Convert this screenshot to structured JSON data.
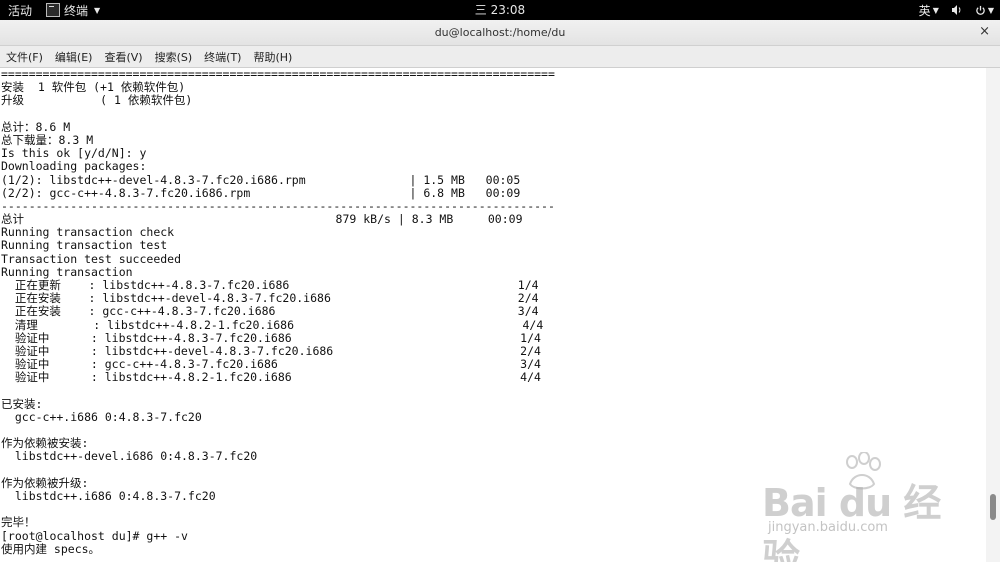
{
  "topbar": {
    "activities": "活动",
    "app_name": "终端",
    "clock": "三 23:08",
    "input_method": "英",
    "power_caret": "▾"
  },
  "window": {
    "title": "du@localhost:/home/du",
    "close_symbol": "×"
  },
  "menu": {
    "items": [
      "文件(F)",
      "编辑(E)",
      "查看(V)",
      "搜索(S)",
      "终端(T)",
      "帮助(H)"
    ]
  },
  "terminal": {
    "lines": [
      "================================================================================",
      "安装  1 软件包 (+1 依赖软件包)",
      "升级           ( 1 依赖软件包)",
      "",
      "总计：8.6 M",
      "总下载量：8.3 M",
      "Is this ok [y/d/N]: y",
      "Downloading packages:",
      "(1/2): libstdc++-devel-4.8.3-7.fc20.i686.rpm               | 1.5 MB   00:05",
      "(2/2): gcc-c++-4.8.3-7.fc20.i686.rpm                       | 6.8 MB   00:09",
      "--------------------------------------------------------------------------------",
      "总计                                             879 kB/s | 8.3 MB     00:09",
      "Running transaction check",
      "Running transaction test",
      "Transaction test succeeded",
      "Running transaction",
      "  正在更新    : libstdc++-4.8.3-7.fc20.i686                                 1/4",
      "  正在安装    : libstdc++-devel-4.8.3-7.fc20.i686                           2/4",
      "  正在安装    : gcc-c++-4.8.3-7.fc20.i686                                   3/4",
      "  清理        : libstdc++-4.8.2-1.fc20.i686                                 4/4",
      "  验证中      : libstdc++-4.8.3-7.fc20.i686                                 1/4",
      "  验证中      : libstdc++-devel-4.8.3-7.fc20.i686                           2/4",
      "  验证中      : gcc-c++-4.8.3-7.fc20.i686                                   3/4",
      "  验证中      : libstdc++-4.8.2-1.fc20.i686                                 4/4",
      "",
      "已安装:",
      "  gcc-c++.i686 0:4.8.3-7.fc20",
      "",
      "作为依赖被安装:",
      "  libstdc++-devel.i686 0:4.8.3-7.fc20",
      "",
      "作为依赖被升级:",
      "  libstdc++.i686 0:4.8.3-7.fc20",
      "",
      "完毕！",
      "[root@localhost du]# g++ -v",
      "使用内建 specs。"
    ]
  },
  "watermark": {
    "brand": "Bai du 经验",
    "url": "jingyan.baidu.com"
  }
}
